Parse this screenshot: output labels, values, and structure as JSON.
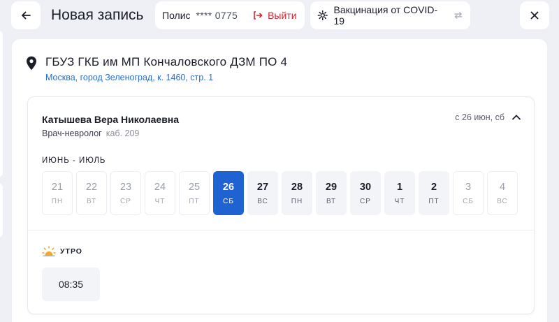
{
  "header": {
    "title": "Новая запись",
    "policy_label": "Полис",
    "policy_number": "**** 0775",
    "logout_label": "Выйти",
    "service_label": "Вакцинация от COVID-19"
  },
  "clinic": {
    "name": "ГБУЗ ГКБ им МП Кончаловского ДЗМ ПО 4",
    "address": "Москва, город Зеленоград, к. 1460, стр. 1"
  },
  "doctor": {
    "name": "Катышева Вера Николаевна",
    "specialty": "Врач-невролог",
    "room": "каб. 209",
    "date_from": "с 26 июн, сб"
  },
  "calendar": {
    "month_label": "ИЮНЬ - ИЮЛЬ",
    "days": [
      {
        "num": "21",
        "wd": "ПН",
        "state": "disabled"
      },
      {
        "num": "22",
        "wd": "ВТ",
        "state": "disabled"
      },
      {
        "num": "23",
        "wd": "СР",
        "state": "disabled"
      },
      {
        "num": "24",
        "wd": "ЧТ",
        "state": "disabled"
      },
      {
        "num": "25",
        "wd": "ПТ",
        "state": "disabled"
      },
      {
        "num": "26",
        "wd": "СБ",
        "state": "selected"
      },
      {
        "num": "27",
        "wd": "ВС",
        "state": "available"
      },
      {
        "num": "28",
        "wd": "ПН",
        "state": "available"
      },
      {
        "num": "29",
        "wd": "ВТ",
        "state": "available"
      },
      {
        "num": "30",
        "wd": "СР",
        "state": "available"
      },
      {
        "num": "1",
        "wd": "ЧТ",
        "state": "available"
      },
      {
        "num": "2",
        "wd": "ПТ",
        "state": "available"
      },
      {
        "num": "3",
        "wd": "СБ",
        "state": "disabled"
      },
      {
        "num": "4",
        "wd": "ВС",
        "state": "disabled"
      }
    ]
  },
  "schedule": {
    "period_label": "УТРО",
    "slots": [
      "08:35"
    ]
  },
  "colors": {
    "accent": "#1f62d1",
    "logout": "#d1262f",
    "link": "#2a6fd1",
    "sun": "#f5a623"
  },
  "icons": {
    "back": "arrow-left-icon",
    "logout": "logout-icon",
    "service": "gear-icon",
    "swap": "swap-icon",
    "close": "close-icon",
    "location": "location-pin-icon",
    "collapse": "chevron-up-icon",
    "period": "sun-icon"
  }
}
